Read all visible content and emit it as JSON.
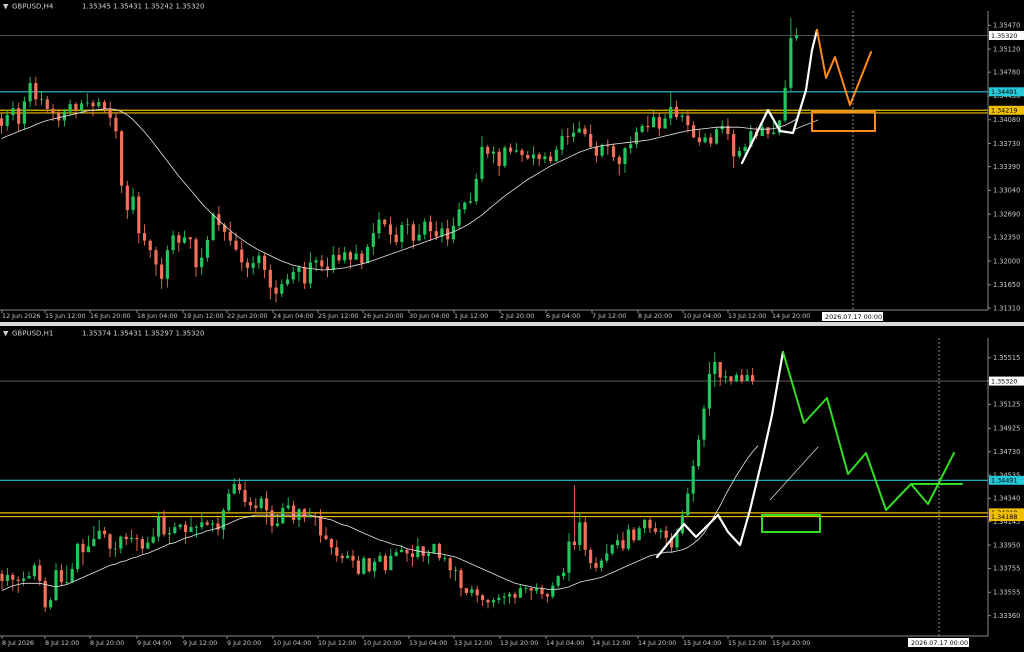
{
  "panels": [
    {
      "title": "GBPUSD,H4",
      "ohlc": "1.35345 1.35431 1.35242 1.35320",
      "price_range": [
        1.3128,
        1.3568
      ],
      "y_ticks": [
        "1.35470",
        "1.35120",
        "1.34780",
        "1.34430",
        "1.34080",
        "1.33730",
        "1.33390",
        "1.33040",
        "1.32690",
        "1.32350",
        "1.32000",
        "1.31650",
        "1.31310"
      ],
      "x_labels": [
        "12 Jun 2026",
        "15 Jun 12:00",
        "16 Jun 20:00",
        "18 Jun 04:00",
        "19 Jun 12:00",
        "22 Jun 20:00",
        "24 Jun 04:00",
        "25 Jun 12:00",
        "26 Jun 20:00",
        "30 Jun 04:00",
        "1 Jul 12:00",
        "2 Jul 20:00",
        "6 Jul 04:00",
        "7 Jul 12:00",
        "8 Jul 20:00",
        "10 Jul 04:00",
        "13 Jul 12:00",
        "14 Jul 20:00"
      ],
      "cursor_time": "2026.07.17 00:00",
      "current_price_label": "1.35320",
      "levels": [
        {
          "price": 1.34491,
          "label": "1.34491",
          "color": "#27c8d8",
          "show_label": true
        },
        {
          "price": 1.34219,
          "label": "1.34219",
          "color": "#f0c000",
          "show_label": true
        },
        {
          "price": 1.3418,
          "label": "",
          "color": "#f0c000",
          "show_label": false
        }
      ],
      "candles": "1.3410,1.3399,1.3418,1.3387;1.3399,1.3415,1.3423,1.3392;1.3415,1.3425,1.3435,1.3407;1.3425,1.3402,1.3433,1.3391;1.3402,1.3435,1.3442,1.3393;1.3435,1.3462,1.3471,1.3427;1.3462,1.3438,1.3471,1.3428;1.3438,1.3438,1.3450,1.3430;1.3438,1.3424,1.3443,1.3418;1.3424,1.3418,1.3431,1.3406;1.3418,1.3407,1.3424,1.3397;1.3407,1.3420,1.3424,1.3398;1.3420,1.3431,1.3438,1.3413;1.3431,1.3422,1.3434,1.3410;1.3422,1.3432,1.3437,1.3417;1.3432,1.3433,1.3447,1.3427;1.3433,1.3428,1.3437,1.3413;1.3428,1.3434,1.3440,1.3425;1.3434,1.3424,1.3437,1.3418;1.3424,1.3411,1.3435,1.3398;1.3411,1.3391,1.3419,1.3380;1.3391,1.3311,1.3393,1.3300;1.3311,1.3275,1.3318,1.3262;1.3275,1.3295,1.3308,1.3269;1.3295,1.3241,1.3302,1.3226;1.3241,1.3230,1.3254,1.3223;1.3230,1.3216,1.3232,1.3205;1.3216,1.3195,1.3221,1.3178;1.3195,1.3174,1.3205,1.3159;1.3174,1.3216,1.3223,1.3161;1.3216,1.3238,1.3245,1.3210;1.3238,1.3227,1.3243,1.3214;1.3227,1.3235,1.3245,1.3225;1.3235,1.3232,1.3236,1.3218;1.3232,1.3191,1.3235,1.3177;1.3191,1.3205,1.3219,1.3180;1.3205,1.3231,1.3237,1.3199;1.3231,1.3269,1.3272,1.3229;1.3269,1.3253,1.3281,1.3244;1.3253,1.3243,1.3256,1.3230;1.3243,1.3230,1.3258,1.3223;1.3230,1.3217,1.3242,1.3214;1.3217,1.3198,1.3230,1.3186;1.3198,1.3190,1.3204,1.3176;1.3190,1.3197,1.3207,1.3180;1.3197,1.3208,1.3213,1.3189;1.3208,1.3187,1.3212,1.3175;1.3187,1.3161,1.3195,1.3144;1.3161,1.3152,1.3172,1.3139;1.3152,1.3166,1.3173,1.3147;1.3166,1.3173,1.3181,1.3163;1.3173,1.3184,1.3191,1.3167;1.3184,1.3191,1.3194,1.3170;1.3191,1.3167,1.3199,1.3159;1.3167,1.3198,1.3213,1.3160;1.3198,1.3201,1.3206,1.3185;1.3201,1.3192,1.3209,1.3185;1.3192,1.3187,1.3205,1.3176;1.3187,1.3209,1.3222,1.3182;1.3209,1.3201,1.3220,1.3196;1.3201,1.3213,1.3221,1.3197;1.3213,1.3202,1.3216,1.3188;1.3202,1.3211,1.3224,1.3208;1.3211,1.3197,1.3216,1.3188;1.3197,1.3221,1.3225,1.3197;1.3221,1.3241,1.3256,1.3209;1.3241,1.3261,1.3272,1.3233;1.3261,1.3254,1.3262,1.3250;1.3254,1.3239,1.3265,1.3225;1.3239,1.3228,1.3250,1.3223;1.3228,1.3253,1.3258,1.3218;1.3253,1.3254,1.3263,1.3239;1.3254,1.3230,1.3259,1.3218;1.3230,1.3239,1.3254,1.3230;1.3239,1.3258,1.3263,1.3232;1.3258,1.3244,1.3267,1.3229;1.3244,1.3236,1.3259,1.3231;1.3236,1.3248,1.3257,1.3227;1.3248,1.3232,1.3261,1.3222;1.3232,1.3252,1.3264,1.3227;1.3252,1.3276,1.3286,1.3248;1.3276,1.3286,1.3288,1.3270;1.3286,1.3288,1.3300,1.3283;1.3288,1.3321,1.3329,1.3283;1.3321,1.3368,1.3384,1.3316;1.3368,1.3358,1.3371,1.3352;1.3358,1.3361,1.3369,1.3344;1.3361,1.3340,1.3366,1.3325;1.3340,1.3367,1.3370,1.3337;1.3367,1.3361,1.3373,1.3357;1.3361,1.3363,1.3374,1.3359;1.3363,1.3356,1.3366,1.3346;1.3356,1.3351,1.3362,1.3349;1.3351,1.3357,1.3369,1.3341;1.3357,1.3350,1.3360,1.3340;1.3350,1.3354,1.3360,1.3344;1.3354,1.3347,1.3361,1.3343;1.3347,1.3364,1.3370,1.3347;1.3364,1.3384,1.3394,1.3356;1.3384,1.3383,1.3396,1.3371;1.3383,1.3389,1.3403,1.3375;1.3389,1.3395,1.3405,1.3390;1.3395,1.3387,1.3400,1.3383;1.3387,1.3368,1.3401,1.3365;1.3368,1.3355,1.3376,1.3345;1.3355,1.3371,1.3373,1.3352;1.3371,1.3369,1.3379,1.3356;1.3369,1.3353,1.3373,1.3347;1.3353,1.3343,1.3356,1.3326;1.3343,1.3366,1.3368,1.3330;1.3366,1.3372,1.3383,1.3358;1.3372,1.3390,1.3397,1.3366;1.3390,1.3399,1.3402,1.3388;1.3399,1.3397,1.3414,1.3390;1.3397,1.3412,1.3422,1.3402;1.3412,1.3395,1.3418,1.3384;1.3395,1.3410,1.3416,1.3395;1.3410,1.3427,1.3449,1.3400;1.3427,1.3412,1.3436,1.3408;1.3412,1.3414,1.3418,1.3405;1.3414,1.3400,1.3422,1.3389;1.3400,1.3382,1.3406,1.3381;1.3382,1.3375,1.3393,1.3370;1.3375,1.3382,1.3388,1.3373;1.3382,1.3373,1.3388,1.3368;1.3373,1.3394,1.3398,1.3371;1.3394,1.3399,1.3407,1.3388;1.3399,1.3387,1.3410,1.3378;1.3387,1.3354,1.3394,1.3337;1.3354,1.3362,1.3368,1.3351;1.3362,1.3368,1.3373,1.3350;1.3368,1.3391,1.3400,1.3367;1.3391,1.3384,1.3397,1.3380;1.3384,1.3397,1.3402,1.3387;1.3397,1.3387,1.3397,1.3380;1.3387,1.3389,1.3407,1.3386;1.3389,1.3407,1.3408,1.3385;1.3407,1.3455,1.3466,1.3404;1.3455,1.3528,1.3558,1.3448;1.3528,1.3532,1.3543,1.3524",
      "ma": "1.3380,1.3384,1.3387,1.3391,1.3394,1.3397,1.3401,1.3404,1.3407,1.3409,1.3411,1.3413,1.3415,1.3417,1.3419,1.3421,1.3422,1.3423,1.3424,1.3424,1.3423,1.3420,1.3415,1.3408,1.3399,1.3390,1.3380,1.3369,1.3358,1.3347,1.3336,1.3325,1.3315,1.3305,1.3295,1.3285,1.3276,1.3268,1.3260,1.3252,1.3245,1.3238,1.3232,1.3226,1.3221,1.3216,1.3212,1.3208,1.3204,1.3200,1.3197,1.3194,1.3192,1.3190,1.3189,1.3188,1.3187,1.3187,1.3188,1.3189,1.3190,1.3192,1.3194,1.3196,1.3198,1.3201,1.3204,1.3207,1.3210,1.3213,1.3216,1.3219,1.3222,1.3225,1.3228,1.3231,1.3234,1.3237,1.3240,1.3243,1.3247,1.3251,1.3256,1.3262,1.3268,1.3275,1.3282,1.3289,1.3296,1.3302,1.3308,1.3314,1.3320,1.3325,1.3330,1.3335,1.3340,1.3344,1.3348,1.3352,1.3356,1.3360,1.3363,1.3366,1.3368,1.3370,1.3371,1.3372,1.3373,1.3374,1.3375,1.3376,1.3377,1.3378,1.3380,1.3382,1.3384,1.3386,1.3388,1.3390,1.3392,1.3393,1.3394,1.3395,1.3396,1.3397,1.3397,1.3397,1.3397,1.3397,1.3396,1.3395,1.3394,1.3394,1.3394,1.3395,1.3397,1.3400,1.3404,1.3409"
    },
    {
      "title": "GBPUSD,H1",
      "ohlc": "1.35374 1.35431 1.35297 1.35320",
      "price_range": [
        1.3319,
        1.3568
      ],
      "y_ticks": [
        "1.35515",
        "1.35320",
        "1.35125",
        "1.34925",
        "1.34730",
        "1.34535",
        "1.34340",
        "1.34145",
        "1.33950",
        "1.33755",
        "1.33555",
        "1.33360"
      ],
      "x_labels": [
        "8 Jul 2026",
        "8 Jul 12:00",
        "8 Jul 20:00",
        "9 Jul 04:00",
        "9 Jul 12:00",
        "9 Jul 20:00",
        "10 Jul 04:00",
        "10 Jul 12:00",
        "10 Jul 20:00",
        "13 Jul 04:00",
        "13 Jul 12:00",
        "13 Jul 20:00",
        "14 Jul 04:00",
        "14 Jul 12:00",
        "14 Jul 20:00",
        "15 Jul 04:00",
        "15 Jul 12:00",
        "15 Jul 20:00"
      ],
      "cursor_time": "2026.07.17 00:00",
      "current_price_label": "1.35320",
      "levels": [
        {
          "price": 1.34491,
          "label": "1.34491",
          "color": "#27c8d8",
          "show_label": true
        },
        {
          "price": 1.34219,
          "label": "1.34219",
          "color": "#f0c000",
          "show_label": true
        },
        {
          "price": 1.34188,
          "label": "1.34188",
          "color": "#f0c000",
          "show_label": true
        }
      ],
      "candles": "1.3371,1.3365,1.3374,1.3358;1.3365,1.3370,1.3376,1.3361;1.3370,1.3366,1.3372,1.3357;1.3366,1.3365,1.3369,1.3355;1.3365,1.3367,1.3373,1.3361;1.3367,1.3369,1.3373,1.3367;1.3369,1.3378,1.3380,1.3366;1.3378,1.3365,1.3383,1.3361;1.3365,1.3343,1.3368,1.3339;1.3343,1.3349,1.3351,1.3341;1.3349,1.3374,1.3380,1.3348;1.3374,1.3364,1.3379,1.3361;1.3364,1.3364,1.3378,1.3362;1.3364,1.3375,1.3380,1.3363;1.3375,1.3396,1.3397,1.3372;1.3396,1.3389,1.3400,1.3378;1.3389,1.3394,1.3403,1.3390;1.3394,1.3400,1.3411,1.3396;1.3400,1.3407,1.3416,1.3405;1.3407,1.3404,1.3410,1.3401;1.3404,1.3392,1.3405,1.3385;1.3392,1.3392,1.3398,1.3385;1.3392,1.3402,1.3403,1.3388;1.3402,1.3400,1.3405,1.3395;1.3400,1.3401,1.3408,1.3397;1.3401,1.3400,1.3404,1.3390;1.3400,1.3392,1.3402,1.3388;1.3392,1.3397,1.3402,1.3394;1.3397,1.3402,1.3409,1.3396;1.3402,1.3419,1.3423,1.3398;1.3419,1.3404,1.3424,1.3402;1.3404,1.3405,1.3410,1.3396;1.3405,1.3410,1.3414,1.3404;1.3410,1.3412,1.3413,1.3408;1.3412,1.3406,1.3415,1.3396;1.3406,1.3410,1.3418,1.3406;1.3410,1.3410,1.3412,1.3401;1.3410,1.3414,1.3422,1.3408;1.3414,1.3412,1.3416,1.3411;1.3412,1.3413,1.3416,1.3406;1.3413,1.3408,1.3418,1.3403;1.3408,1.3424,1.3426,1.3400;1.3424,1.3438,1.3442,1.3422;1.3438,1.3446,1.3451,1.3437;1.3446,1.3441,1.3451,1.3438;1.3441,1.3431,1.3448,1.3427;1.3431,1.3428,1.3435,1.3424;1.3428,1.3426,1.3434,1.3422;1.3426,1.3434,1.3436,1.3424;1.3434,1.3424,1.3440,1.3412;1.3424,1.3411,1.3428,1.3405;1.3411,1.3413,1.3421,1.3410;1.3413,1.3426,1.3430,1.3413;1.3426,1.3428,1.3435,1.3424;1.3428,1.3416,1.3432,1.3413;1.3416,1.3425,1.3426,1.3410;1.3425,1.3418,1.3426,1.3414;1.3418,1.3419,1.3426,1.3419;1.3419,1.3418,1.3422,1.3411;1.3418,1.3403,1.3425,1.3397;1.3403,1.3400,1.3410,1.3399;1.3400,1.3393,1.3401,1.3387;1.3393,1.3386,1.3399,1.3381;1.3386,1.3384,1.3388,1.3380;1.3384,1.3386,1.3390,1.3384;1.3386,1.3382,1.3391,1.3376;1.3382,1.3371,1.3386,1.3370;1.3371,1.3384,1.3386,1.3370;1.3384,1.3373,1.3384,1.3372;1.3373,1.3381,1.3384,1.3368;1.3381,1.3386,1.3389,1.3381;1.3386,1.3374,1.3388,1.3371;1.3374,1.3386,1.3392,1.3374;1.3386,1.3389,1.3392,1.3385;1.3389,1.3391,1.3395,1.3391;1.3391,1.3388,1.3392,1.3381;1.3388,1.3385,1.3395,1.3377;1.3385,1.3394,1.3401,1.3383;1.3394,1.3386,1.3394,1.3381;1.3386,1.3388,1.3391,1.3379;1.3388,1.3396,1.3396,1.3389;1.3396,1.3384,1.3397,1.3382;1.3384,1.3384,1.3387,1.3381;1.3384,1.3374,1.3385,1.3367;1.3374,1.3374,1.3377,1.3365;1.3374,1.3359,1.3376,1.3352;1.3359,1.3355,1.3359,1.3353;1.3355,1.3358,1.3361,1.3352;1.3358,1.3353,1.3361,1.3347;1.3353,1.3349,1.3354,1.3344;1.3349,1.3347,1.3350,1.3342;1.3347,1.3349,1.3351,1.3343;1.3349,1.3351,1.3354,1.3346;1.3351,1.3352,1.3355,1.3345;1.3352,1.3354,1.3356,1.3346;1.3354,1.3351,1.3356,1.3346;1.3351,1.3359,1.3362,1.3351;1.3359,1.3359,1.3361,1.3355;1.3359,1.3357,1.3360,1.3349;1.3357,1.3359,1.3363,1.3354;1.3359,1.3354,1.3362,1.3350;1.3354,1.3352,1.3355,1.3347;1.3352,1.3361,1.3364,1.3350;1.3361,1.3369,1.3370,1.3359;1.3369,1.3372,1.3376,1.3366;1.3372,1.3398,1.3405,1.3365;1.3398,1.3395,1.3445,1.3391;1.3395,1.3414,1.3422,1.3390;1.3414,1.3391,1.3418,1.3386;1.3391,1.3380,1.3393,1.3375;1.3380,1.3376,1.3385,1.3373;1.3376,1.3382,1.3384,1.3373;1.3382,1.3388,1.3396,1.3380;1.3388,1.3395,1.3396,1.3386;1.3395,1.3399,1.3404,1.3392;1.3399,1.3392,1.3406,1.3390;1.3392,1.3408,1.3412,1.3390;1.3408,1.3399,1.3410,1.3397;1.3399,1.3409,1.3411,1.3399;1.3409,1.3416,1.3417,1.3405;1.3416,1.3409,1.3418,1.3405;1.3409,1.3406,1.3414,1.3404;1.3406,1.3407,1.3409,1.3400;1.3407,1.3401,1.3411,1.3396;1.3401,1.3393,1.3405,1.3389;1.3393,1.3405,1.3409,1.3391;1.3405,1.3420,1.3424,1.3403;1.3420,1.3438,1.3443,1.3418;1.3438,1.3461,1.3466,1.3431;1.3461,1.3483,1.3487,1.3458;1.3483,1.3509,1.3512,1.3477;1.3509,1.3538,1.3548,1.3503;1.3538,1.3548,1.3556,1.3527;1.3548,1.3535,1.3546,1.3528;1.3535,1.3536,1.3541,1.3530;1.3536,1.3532,1.3536,1.3529;1.3532,1.3537,1.3539,1.3531;1.3537,1.3532,1.3542,1.3530;1.3532,1.3537,1.3542,1.3532;1.3537,1.3532,1.3543,1.3529",
      "ma": "1.3357,1.3359,1.3361,1.3362,1.3363,1.3363,1.3363,1.3363,1.3362,1.3361,1.3360,1.3361,1.3362,1.3364,1.3366,1.3368,1.3370,1.3372,1.3374,1.3376,1.3378,1.3379,1.3381,1.3382,1.3384,1.3385,1.3387,1.3388,1.3390,1.3392,1.3394,1.3396,1.3397,1.3399,1.3401,1.3402,1.3404,1.3405,1.3407,1.3408,1.3409,1.3411,1.3413,1.3415,1.3417,1.3418,1.3419,1.3420,1.3420,1.3420,1.3420,1.3420,1.3420,1.3420,1.3420,1.3420,1.3420,1.3420,1.3419,1.3418,1.3417,1.3416,1.3414,1.3412,1.3411,1.3409,1.3407,1.3405,1.3403,1.3401,1.3399,1.3398,1.3396,1.3395,1.3394,1.3392,1.3391,1.3390,1.3389,1.3389,1.3388,1.3388,1.3387,1.3386,1.3385,1.3383,1.3381,1.3379,1.3377,1.3375,1.3373,1.3371,1.3369,1.3367,1.3365,1.3363,1.3362,1.3361,1.3360,1.3359,1.3359,1.3358,1.3358,1.3358,1.3359,1.3360,1.3362,1.3364,1.3365,1.3366,1.3367,1.3368,1.3370,1.3372,1.3374,1.3376,1.3378,1.3380,1.3382,1.3384,1.3386,1.3387,1.3388,1.3389,1.3389,1.3390,1.3391,1.3393,1.3396,1.3400,1.3405,1.3412,1.3420,1.3428,1.3437,1.3445,1.3453,1.3460,1.3467,1.3473,1.3478"
    }
  ],
  "colors": {
    "background": "#000000",
    "bull": "#22c55e",
    "bear": "#f4705a",
    "text": "#c8c8c8",
    "white_path": "#ffffff",
    "orange_path": "#ff8c1a",
    "green_path": "#33dd22"
  }
}
